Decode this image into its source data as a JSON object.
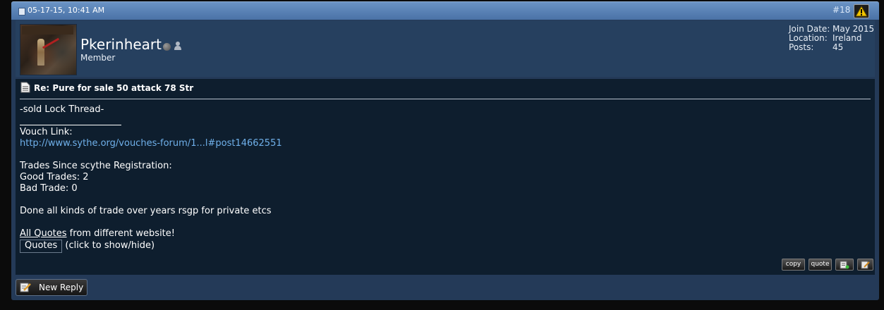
{
  "post": {
    "date": "05-17-15, 10:41 AM",
    "number": "#18"
  },
  "user": {
    "name": "Pkerinheart",
    "title": "Member",
    "stats": [
      {
        "label": "Join Date:",
        "value": "May 2015"
      },
      {
        "label": "Location:",
        "value": "Ireland"
      },
      {
        "label": "Posts:",
        "value": "45"
      }
    ]
  },
  "message": {
    "title": "Re: Pure for sale 50 attack 78 Str",
    "body": "-sold Lock Thread-",
    "signature": {
      "vouch_label": "Vouch Link:",
      "vouch_link": "http://www.sythe.org/vouches-forum/1...l#post14662551",
      "trades_heading": "Trades Since scythe Registration:",
      "good_trades": "Good Trades: 2",
      "bad_trades": "Bad Trade: 0",
      "experience": "Done all kinds of trade over years rsgp for private etcs",
      "quotes_line_underlined": "All Quotes",
      "quotes_line_rest": " from different website!",
      "quotes_button": "Quotes",
      "quotes_hint": " (click to show/hide)"
    }
  },
  "actions": {
    "copy": "copy",
    "quote": "quote",
    "new_reply": "New Reply"
  },
  "icons": {
    "warn": "warning-icon",
    "status": "offline-status-icon",
    "profile": "user-profile-icon",
    "title": "document-icon",
    "multiquote": "multiquote-icon",
    "edit": "edit-icon",
    "reply": "new-reply-icon"
  },
  "colors": {
    "header": "#5a82b6",
    "userinfo_bg": "#26405f",
    "body_bg": "#0e1e2e",
    "link": "#6fb0ea"
  }
}
